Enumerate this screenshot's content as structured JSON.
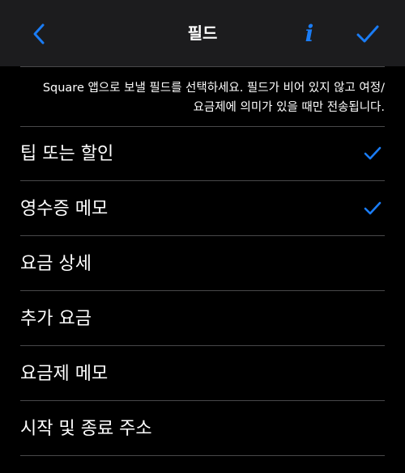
{
  "nav": {
    "title": "필드",
    "info_label": "i"
  },
  "description": {
    "line1": "Square 앱으로 보낼 필드를 선택하세요. 필드가 비어 있지 않고 여정/",
    "line2": "요금제에 의미가 있을 때만 전송됩니다."
  },
  "fields": [
    {
      "label": "팁 또는 할인",
      "checked": true
    },
    {
      "label": "영수증 메모",
      "checked": true
    },
    {
      "label": "요금 상세",
      "checked": false
    },
    {
      "label": "추가 요금",
      "checked": false
    },
    {
      "label": "요금제 메모",
      "checked": false
    },
    {
      "label": "시작 및 종료 주소",
      "checked": false
    }
  ],
  "colors": {
    "accent": "#1a7cf5",
    "nav_background": "#1c1c1e",
    "background": "#000000",
    "separator": "#48484a"
  },
  "icons": {
    "back": "chevron-left-icon",
    "info": "info-icon",
    "done": "checkmark-icon",
    "row_check": "checkmark-icon"
  }
}
